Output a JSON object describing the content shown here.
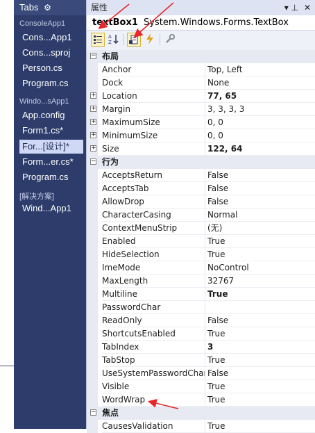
{
  "tabs_panel": {
    "title": "Tabs",
    "gear_icon": "gear-icon",
    "groups": [
      {
        "label": "ConsoleApp1",
        "items": [
          "Cons...App1",
          "Cons...sproj",
          "Person.cs",
          "Program.cs"
        ]
      },
      {
        "label": "Windo...sApp1",
        "items": [
          "App.config",
          "Form1.cs*",
          "For...[设计]*",
          "Form...er.cs*",
          "Program.cs"
        ]
      },
      {
        "label": "[解决方案]",
        "items": [
          "Wind...App1"
        ]
      }
    ],
    "active_item": "For...[设计]*"
  },
  "properties": {
    "title": "属性",
    "pin": "▾ ⊥",
    "close": "✕",
    "object_name": "textBox1",
    "object_type": "System.Windows.Forms.TextBox",
    "toolbar": {
      "categorized_icon": "categorized-icon",
      "alphabetical_icon": "alphabetical-icon",
      "properties_icon": "properties-icon",
      "events_icon": "lightning-icon",
      "property_pages_icon": "wrench-icon",
      "active_button": "properties"
    },
    "categories": [
      {
        "label": "布局",
        "rows": [
          {
            "name": "Anchor",
            "value": "Top, Left",
            "bold": false,
            "expandable": false
          },
          {
            "name": "Dock",
            "value": "None",
            "bold": false,
            "expandable": false
          },
          {
            "name": "Location",
            "value": "77, 65",
            "bold": true,
            "expandable": true
          },
          {
            "name": "Margin",
            "value": "3, 3, 3, 3",
            "bold": false,
            "expandable": true
          },
          {
            "name": "MaximumSize",
            "value": "0, 0",
            "bold": false,
            "expandable": true
          },
          {
            "name": "MinimumSize",
            "value": "0, 0",
            "bold": false,
            "expandable": true
          },
          {
            "name": "Size",
            "value": "122, 64",
            "bold": true,
            "expandable": true
          }
        ]
      },
      {
        "label": "行为",
        "rows": [
          {
            "name": "AcceptsReturn",
            "value": "False",
            "bold": false,
            "expandable": false
          },
          {
            "name": "AcceptsTab",
            "value": "False",
            "bold": false,
            "expandable": false
          },
          {
            "name": "AllowDrop",
            "value": "False",
            "bold": false,
            "expandable": false
          },
          {
            "name": "CharacterCasing",
            "value": "Normal",
            "bold": false,
            "expandable": false
          },
          {
            "name": "ContextMenuStrip",
            "value": "(无)",
            "bold": false,
            "expandable": false
          },
          {
            "name": "Enabled",
            "value": "True",
            "bold": false,
            "expandable": false
          },
          {
            "name": "HideSelection",
            "value": "True",
            "bold": false,
            "expandable": false
          },
          {
            "name": "ImeMode",
            "value": "NoControl",
            "bold": false,
            "expandable": false
          },
          {
            "name": "MaxLength",
            "value": "32767",
            "bold": false,
            "expandable": false
          },
          {
            "name": "Multiline",
            "value": "True",
            "bold": true,
            "expandable": false
          },
          {
            "name": "PasswordChar",
            "value": "",
            "bold": false,
            "expandable": false
          },
          {
            "name": "ReadOnly",
            "value": "False",
            "bold": false,
            "expandable": false
          },
          {
            "name": "ShortcutsEnabled",
            "value": "True",
            "bold": false,
            "expandable": false
          },
          {
            "name": "TabIndex",
            "value": "3",
            "bold": true,
            "expandable": false
          },
          {
            "name": "TabStop",
            "value": "True",
            "bold": false,
            "expandable": false
          },
          {
            "name": "UseSystemPasswordChar",
            "value": "False",
            "bold": false,
            "expandable": false
          },
          {
            "name": "Visible",
            "value": "True",
            "bold": false,
            "expandable": false
          },
          {
            "name": "WordWrap",
            "value": "True",
            "bold": false,
            "expandable": false
          }
        ]
      },
      {
        "label": "焦点",
        "rows": [
          {
            "name": "CausesValidation",
            "value": "True",
            "bold": false,
            "expandable": false
          }
        ]
      }
    ]
  },
  "annotations": {
    "arrow_color": "#e8262b",
    "arrows": [
      "arrow-to-object-name",
      "arrow-to-properties-button",
      "arrow-to-wordwrap"
    ]
  }
}
